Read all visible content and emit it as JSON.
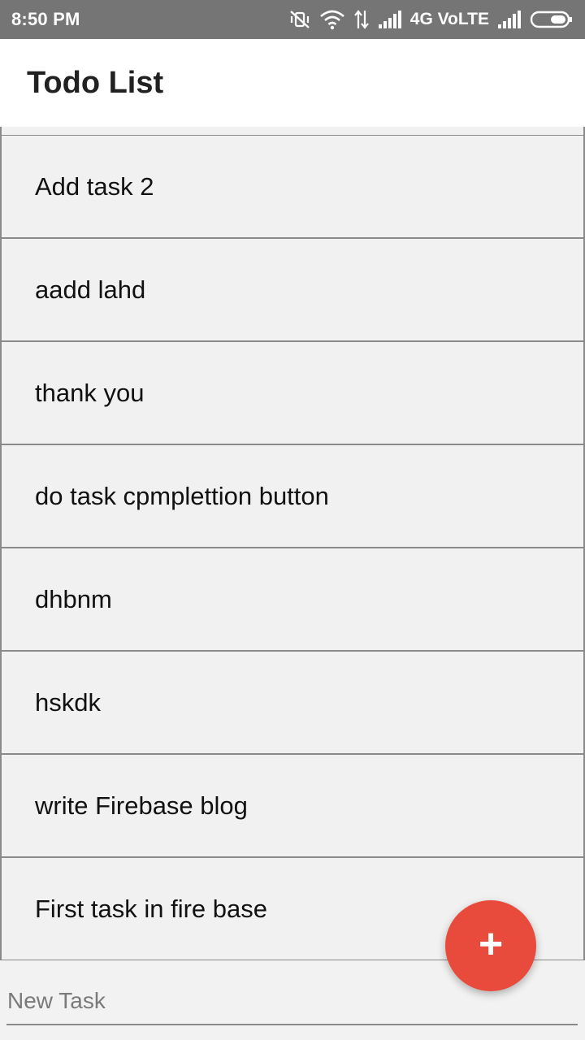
{
  "status_bar": {
    "time": "8:50 PM",
    "network_label": "4G VoLTE",
    "icons": [
      "vibrate-off-icon",
      "wifi-icon",
      "data-transfer-icon",
      "signal-icon",
      "signal-icon-2",
      "battery-icon"
    ]
  },
  "app_bar": {
    "title": "Todo List"
  },
  "tasks": [
    {
      "label": "Add task 2"
    },
    {
      "label": "aadd lahd"
    },
    {
      "label": "thank you"
    },
    {
      "label": "do task cpmplettion button"
    },
    {
      "label": "dhbnm"
    },
    {
      "label": "hskdk"
    },
    {
      "label": "write Firebase blog"
    },
    {
      "label": "First task in fire base"
    }
  ],
  "new_task": {
    "placeholder": "New Task",
    "value": ""
  },
  "fab": {
    "icon": "plus-icon",
    "symbol": "+",
    "color": "#e84a3c"
  }
}
